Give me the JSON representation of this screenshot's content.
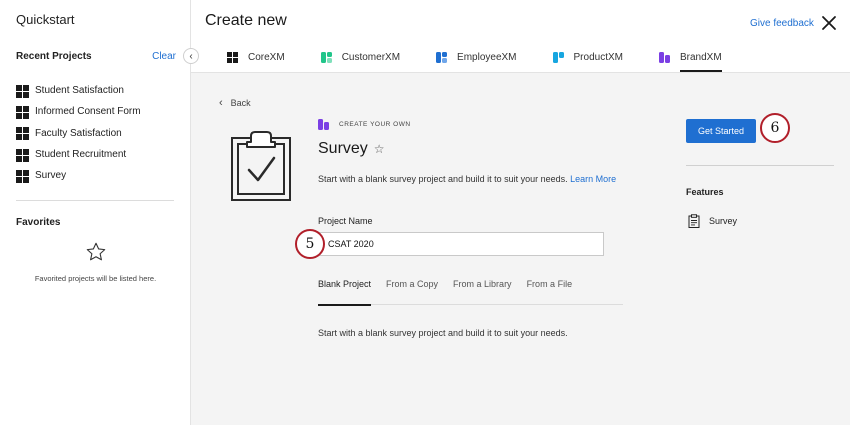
{
  "sidebar": {
    "title": "Quickstart",
    "recent_heading": "Recent Projects",
    "clear_label": "Clear",
    "recent_items": [
      {
        "label": "Student Satisfaction"
      },
      {
        "label": "Informed Consent Form"
      },
      {
        "label": "Faculty Satisfaction"
      },
      {
        "label": "Student Recruitment"
      },
      {
        "label": "Survey"
      }
    ],
    "favorites_heading": "Favorites",
    "favorites_note": "Favorited projects will be listed here.",
    "collapse_glyph": "‹"
  },
  "header": {
    "title": "Create new",
    "feedback_label": "Give feedback",
    "tabs": [
      {
        "label": "CoreXM",
        "icon": "corexm-grid-icon",
        "color": "#1a1a1a"
      },
      {
        "label": "CustomerXM",
        "icon": "customerxm-icon",
        "color": "#21c58a"
      },
      {
        "label": "EmployeeXM",
        "icon": "employeexm-icon",
        "color": "#1f6fd1"
      },
      {
        "label": "ProductXM",
        "icon": "productxm-icon",
        "color": "#17a6e0"
      },
      {
        "label": "BrandXM",
        "icon": "brandxm-icon",
        "color": "#7b3fe4",
        "active": true
      }
    ]
  },
  "main": {
    "back_label": "Back",
    "brand_tag": "CREATE YOUR OWN",
    "title": "Survey",
    "star_glyph": "☆",
    "description": "Start with a blank survey project and build it to suit your needs.",
    "learn_more": "Learn More",
    "project_name_label": "Project Name",
    "project_name_value": "CSAT 2020",
    "subtabs": [
      {
        "label": "Blank Project",
        "active": true
      },
      {
        "label": "From a Copy"
      },
      {
        "label": "From a Library"
      },
      {
        "label": "From a File"
      }
    ],
    "subtab_description": "Start with a blank survey project and build it to suit your needs."
  },
  "right": {
    "get_started_label": "Get Started",
    "features_heading": "Features",
    "features": [
      {
        "label": "Survey",
        "icon": "clipboard-icon"
      }
    ]
  },
  "callouts": {
    "five": "5",
    "six": "6"
  },
  "colors": {
    "accent": "#1f6fd1",
    "brand": "#7b3fe4",
    "callout": "#b11f2a"
  }
}
